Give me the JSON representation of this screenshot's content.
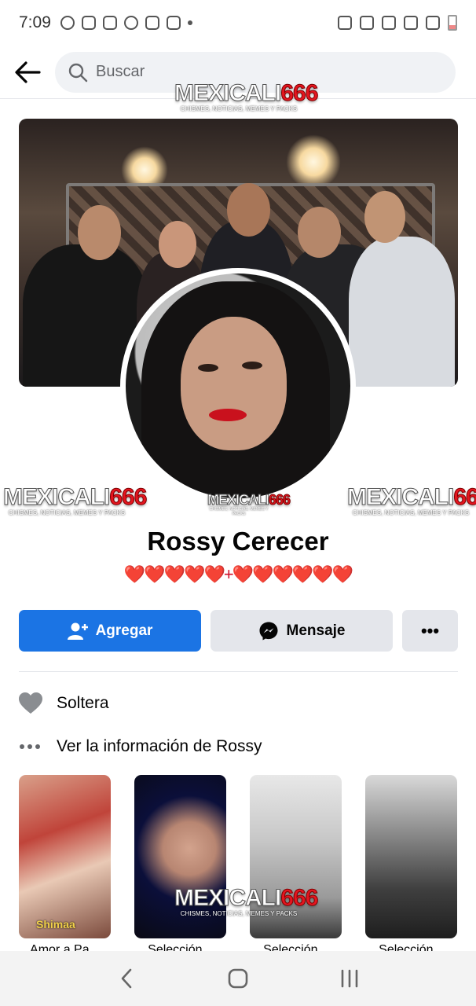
{
  "status_bar": {
    "time": "7:09"
  },
  "search": {
    "placeholder": "Buscar"
  },
  "watermark": {
    "brand_word": "MEXICALI",
    "brand_number": "666",
    "tagline": "CHISMES, NOTICIAS, MEMES Y PACKS"
  },
  "profile": {
    "name": "Rossy Cerecer",
    "bio": "❤️❤️❤️❤️❤️+❤️❤️❤️❤️❤️❤️"
  },
  "actions": {
    "add_label": "Agregar",
    "message_label": "Mensaje",
    "more_label": "•••"
  },
  "info": {
    "relationship": "Soltera",
    "see_more": "Ver la información de Rossy"
  },
  "photos": [
    {
      "label": "Amor a Pa...",
      "overlay": "Shimaa"
    },
    {
      "label": "Selección..."
    },
    {
      "label": "Selección..."
    },
    {
      "label": "Selección..."
    }
  ],
  "colors": {
    "accent": "#1b74e4",
    "button_gray": "#e4e6eb",
    "heart_red": "#d0102a",
    "watermark_red": "#e4151f"
  },
  "icons": [
    "back-arrow-icon",
    "search-icon",
    "add-friend-icon",
    "messenger-icon",
    "heart-icon",
    "more-dots-icon",
    "nav-back-icon",
    "nav-home-icon",
    "nav-recent-icon"
  ]
}
